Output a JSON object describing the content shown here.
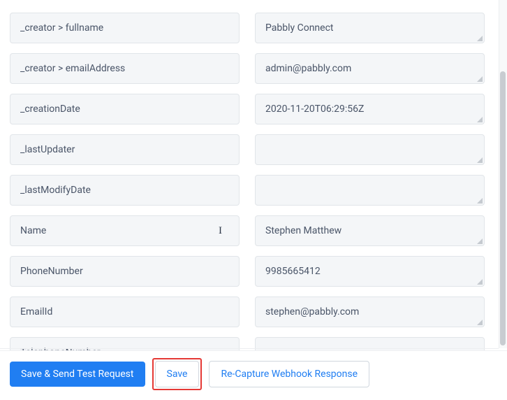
{
  "rows": [
    {
      "label": "_creator > fullname",
      "value": "Pabbly Connect"
    },
    {
      "label": "_creator > emailAddress",
      "value": "admin@pabbly.com"
    },
    {
      "label": "_creationDate",
      "value": "2020-11-20T06:29:56Z"
    },
    {
      "label": "_lastUpdater",
      "value": ""
    },
    {
      "label": "_lastModifyDate",
      "value": ""
    },
    {
      "label": "Name",
      "value": "Stephen Matthew"
    },
    {
      "label": "PhoneNumber",
      "value": "9985665412"
    },
    {
      "label": "EmailId",
      "value": "stephen@pabbly.com"
    },
    {
      "label": "TelephoneNumber",
      "value": ""
    }
  ],
  "buttons": {
    "saveSend": "Save & Send Test Request",
    "save": "Save",
    "recapture": "Re-Capture Webhook Response"
  }
}
